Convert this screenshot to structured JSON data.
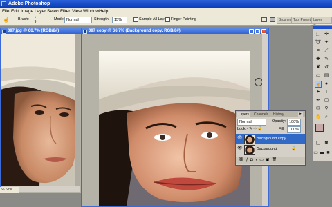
{
  "app": {
    "title": "Adobe Photoshop"
  },
  "menu": [
    "File",
    "Edit",
    "Image",
    "Layer",
    "Select",
    "Filter",
    "View",
    "Window",
    "Help"
  ],
  "options": {
    "brush_label": "Brush:",
    "brush_size": "9",
    "mode_label": "Mode:",
    "mode_value": "Normal",
    "strength_label": "Strength:",
    "strength_value": "15%",
    "sample_all_layers": "Sample All Layers",
    "finger_painting": "Finger Painting"
  },
  "palette_well": {
    "tabs": [
      "Brushes",
      "Tool Presets",
      "Layer Comps"
    ]
  },
  "doc_back": {
    "title": "097.jpg @ 66.7% (RGB/8#)",
    "zoom": "66.67%"
  },
  "doc_front": {
    "title": "097 copy @ 66.7% (Background copy, RGB/8#)"
  },
  "layers_panel": {
    "tabs": [
      "Layers",
      "Channels",
      "History"
    ],
    "blend_mode": "Normal",
    "opacity_label": "Opacity:",
    "opacity": "100%",
    "lock_label": "Lock:",
    "fill_label": "Fill:",
    "fill": "100%",
    "layers": [
      {
        "name": "Background copy",
        "selected": true
      },
      {
        "name": "Background",
        "selected": false
      }
    ]
  },
  "colors": {
    "titlebar": "#0a3cb8",
    "selection": "#3169c6",
    "chrome": "#ece9d8"
  }
}
